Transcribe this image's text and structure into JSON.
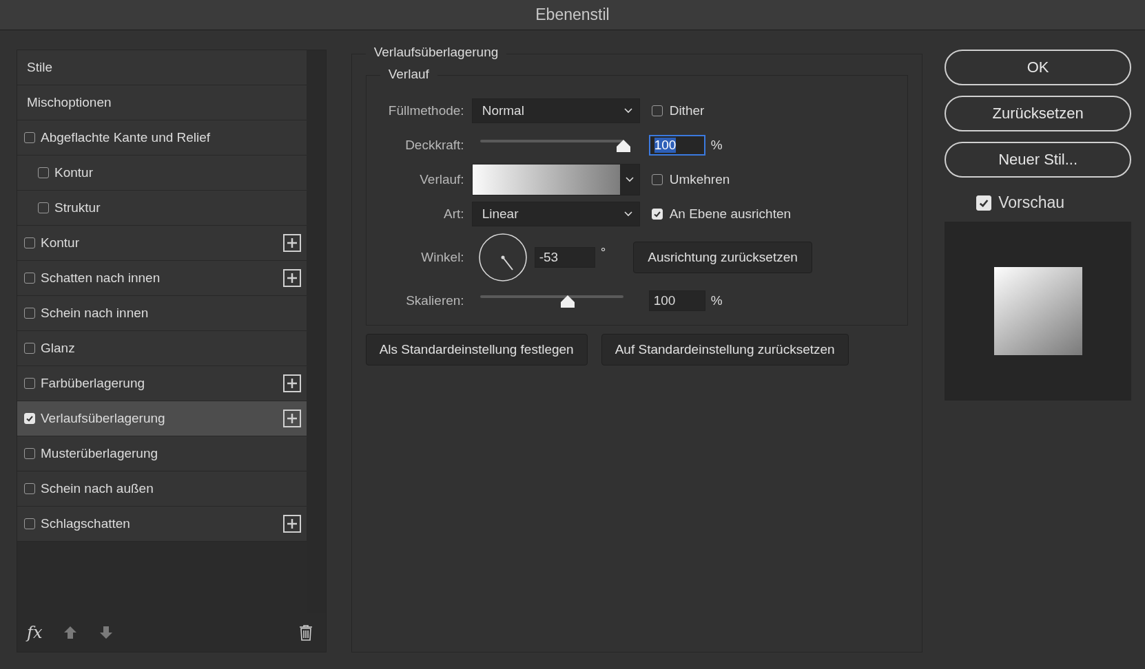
{
  "window": {
    "title": "Ebenenstil"
  },
  "sidebar": {
    "items": [
      {
        "kind": "header",
        "label": "Stile",
        "selected": false
      },
      {
        "kind": "header",
        "label": "Mischoptionen",
        "selected": false
      },
      {
        "kind": "option",
        "label": "Abgeflachte Kante und Relief",
        "checked": false,
        "selected": false,
        "addable": false,
        "children": [
          {
            "kind": "option",
            "label": "Kontur",
            "checked": false,
            "selected": false,
            "addable": false
          },
          {
            "kind": "option",
            "label": "Struktur",
            "checked": false,
            "selected": false,
            "addable": false
          }
        ]
      },
      {
        "kind": "option",
        "label": "Kontur",
        "checked": false,
        "selected": false,
        "addable": true
      },
      {
        "kind": "option",
        "label": "Schatten nach innen",
        "checked": false,
        "selected": false,
        "addable": true
      },
      {
        "kind": "option",
        "label": "Schein nach innen",
        "checked": false,
        "selected": false,
        "addable": false
      },
      {
        "kind": "option",
        "label": "Glanz",
        "checked": false,
        "selected": false,
        "addable": false
      },
      {
        "kind": "option",
        "label": "Farbüberlagerung",
        "checked": false,
        "selected": false,
        "addable": true
      },
      {
        "kind": "option",
        "label": "Verlaufsüberlagerung",
        "checked": true,
        "selected": true,
        "addable": true
      },
      {
        "kind": "option",
        "label": "Musterüberlagerung",
        "checked": false,
        "selected": false,
        "addable": false
      },
      {
        "kind": "option",
        "label": "Schein nach außen",
        "checked": false,
        "selected": false,
        "addable": false
      },
      {
        "kind": "option",
        "label": "Schlagschatten",
        "checked": false,
        "selected": false,
        "addable": true
      }
    ],
    "toolbar": {
      "fx": "fx"
    }
  },
  "panel": {
    "title": "Verlaufsüberlagerung",
    "group_title": "Verlauf",
    "fill_method": {
      "label": "Füllmethode:",
      "value": "Normal"
    },
    "dither": {
      "label": "Dither",
      "checked": false
    },
    "opacity": {
      "label": "Deckkraft:",
      "level": 1.0,
      "value": "100",
      "unit": "%",
      "focused": true
    },
    "gradient": {
      "label": "Verlauf:"
    },
    "reverse": {
      "label": "Umkehren",
      "checked": false
    },
    "style": {
      "label": "Art:",
      "value": "Linear"
    },
    "align": {
      "label": "An Ebene ausrichten",
      "checked": true
    },
    "angle": {
      "label": "Winkel:",
      "value": "-53",
      "unit": "°",
      "reset_button": "Ausrichtung zurücksetzen"
    },
    "scale": {
      "label": "Skalieren:",
      "level": 0.61,
      "value": "100",
      "unit": "%"
    },
    "buttons": [
      "Als Standardeinstellung festlegen",
      "Auf Standardeinstellung zurücksetzen"
    ]
  },
  "actions": {
    "buttons": [
      "OK",
      "Zurücksetzen",
      "Neuer Stil..."
    ],
    "preview": {
      "label": "Vorschau",
      "checked": true
    }
  }
}
